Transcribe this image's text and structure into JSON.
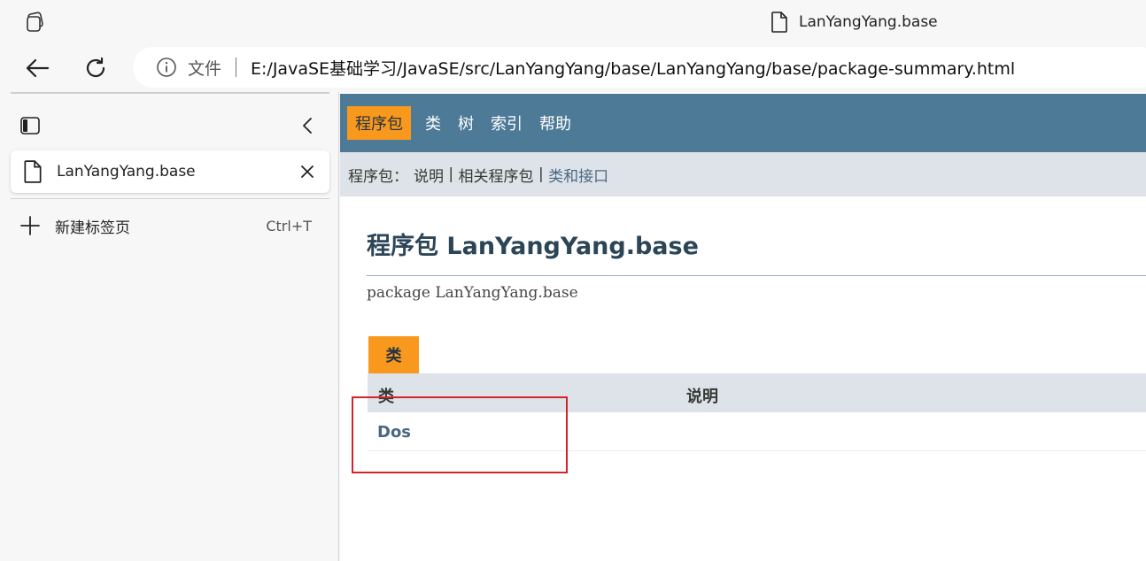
{
  "window": {
    "tab_title": "LanYangYang.base"
  },
  "address_bar": {
    "protocol_label": "文件",
    "url": "E:/JavaSE基础学习/JavaSE/src/LanYangYang/base/LanYangYang/base/package-summary.html"
  },
  "sidebar": {
    "tabs": [
      {
        "label": "LanYangYang.base"
      }
    ],
    "new_tab_label": "新建标签页",
    "new_tab_shortcut": "Ctrl+T"
  },
  "javadoc": {
    "top_nav": [
      "程序包",
      "类",
      "树",
      "索引",
      "帮助"
    ],
    "sub_nav": {
      "prefix": "程序包：",
      "description_link": "说明",
      "sep1": " | ",
      "related_link": "相关程序包",
      "sep2": " | ",
      "classes_link": "类和接口"
    },
    "title": "程序包 LanYangYang.base",
    "signature": "package LanYangYang.base",
    "caption_tab": "类",
    "table": {
      "headers": [
        "类",
        "说明"
      ],
      "rows": [
        {
          "class": "Dos",
          "description": ""
        }
      ]
    }
  },
  "colors": {
    "nav_bg": "#4d7a97",
    "accent_orange": "#f8981d",
    "subnav_bg": "#dee3e9",
    "link": "#4a6782",
    "annotation_red": "#d3242b"
  }
}
